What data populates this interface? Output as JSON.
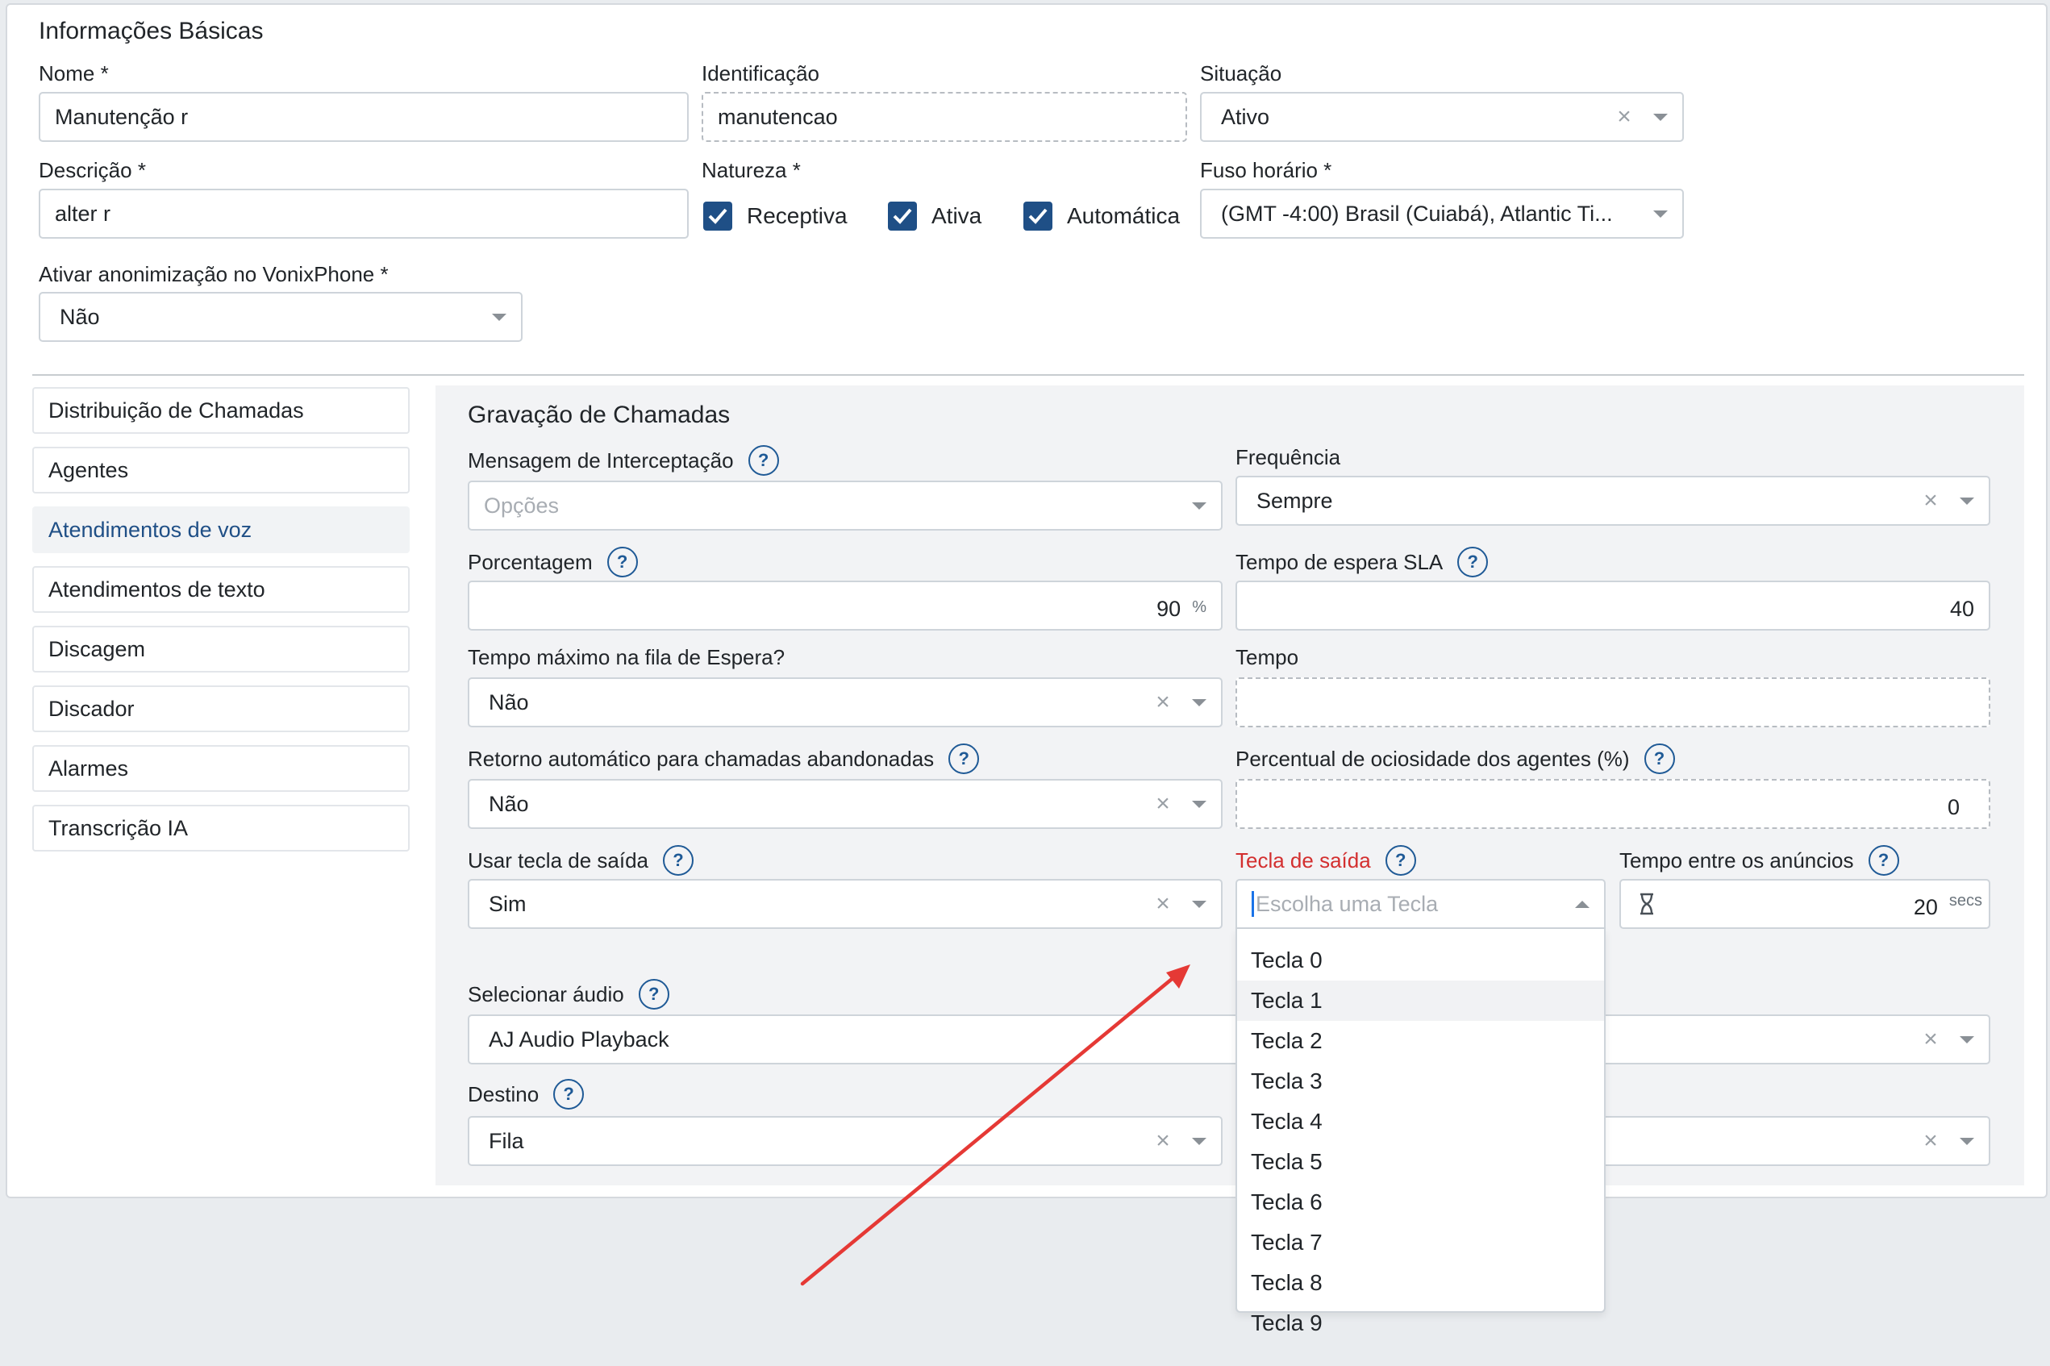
{
  "basic": {
    "title": "Informações Básicas",
    "nome": {
      "label": "Nome *",
      "value": "Manutenção r"
    },
    "identificacao": {
      "label": "Identificação",
      "value": "manutencao"
    },
    "situacao": {
      "label": "Situação",
      "value": "Ativo"
    },
    "descricao": {
      "label": "Descrição *",
      "value": "alter r"
    },
    "natureza": {
      "label": "Natureza *",
      "options": [
        "Receptiva",
        "Ativa",
        "Automática"
      ]
    },
    "fuso": {
      "label": "Fuso horário *",
      "value": "(GMT -4:00) Brasil (Cuiabá), Atlantic Ti..."
    },
    "anonimizacao": {
      "label": "Ativar anonimização no VonixPhone *",
      "value": "Não"
    }
  },
  "sidebar": {
    "items": [
      {
        "label": "Distribuição de Chamadas"
      },
      {
        "label": "Agentes"
      },
      {
        "label": "Atendimentos de voz"
      },
      {
        "label": "Atendimentos de texto"
      },
      {
        "label": "Discagem"
      },
      {
        "label": "Discador"
      },
      {
        "label": "Alarmes"
      },
      {
        "label": "Transcrição IA"
      }
    ],
    "active_index": 2
  },
  "recording": {
    "title": "Gravação de Chamadas",
    "mensagem": {
      "label": "Mensagem de Interceptação",
      "placeholder": "Opções"
    },
    "frequencia": {
      "label": "Frequência",
      "value": "Sempre"
    },
    "porcentagem": {
      "label": "Porcentagem",
      "value": "90",
      "unit": "%"
    },
    "sla": {
      "label": "Tempo de espera SLA",
      "value": "40"
    },
    "tempo_max": {
      "label": "Tempo máximo na fila de Espera?",
      "value": "Não"
    },
    "tempo": {
      "label": "Tempo",
      "value": ""
    },
    "retorno": {
      "label": "Retorno automático para chamadas abandonadas",
      "value": "Não"
    },
    "ociosidade": {
      "label": "Percentual de ociosidade dos agentes (%)",
      "value": "0"
    },
    "usar_tecla": {
      "label": "Usar tecla de saída",
      "value": "Sim"
    },
    "tecla_saida": {
      "label": "Tecla de saída",
      "placeholder": "Escolha uma Tecla",
      "options": [
        "Tecla 0",
        "Tecla 1",
        "Tecla 2",
        "Tecla 3",
        "Tecla 4",
        "Tecla 5",
        "Tecla 6",
        "Tecla 7",
        "Tecla 8",
        "Tecla 9"
      ],
      "highlighted_index": 1
    },
    "tempo_anuncios": {
      "label": "Tempo entre os anúncios",
      "value": "20",
      "unit": "secs"
    },
    "audio": {
      "label": "Selecionar áudio",
      "value": "AJ Audio Playback"
    },
    "destino": {
      "label": "Destino",
      "value": "Fila"
    }
  },
  "icons": {
    "help": "?",
    "clear": "×"
  },
  "colors": {
    "primary": "#1f4f86",
    "error": "#d32f2f",
    "arrow": "#e53935"
  }
}
